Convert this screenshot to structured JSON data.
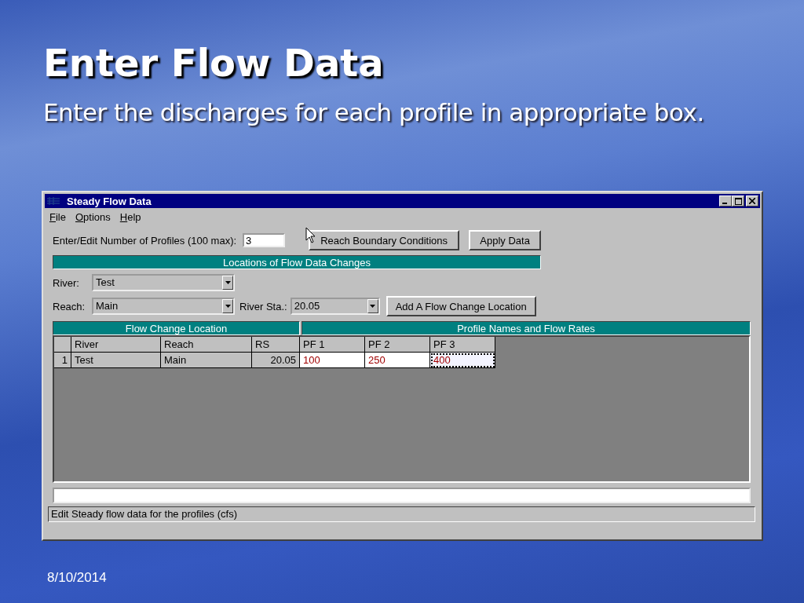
{
  "slide": {
    "title": "Enter Flow Data",
    "subtitle": "Enter the discharges for each profile in appropriate box.",
    "date": "8/10/2014"
  },
  "window": {
    "title": "Steady Flow Data",
    "menu": [
      "File",
      "Options",
      "Help"
    ],
    "profiles": {
      "label": "Enter/Edit Number of Profiles (100 max):",
      "value": "3"
    },
    "buttons": [
      "Reach Boundary Conditions",
      "Apply Data"
    ],
    "section_header": "Locations of Flow Data Changes",
    "river": {
      "label": "River:",
      "value": "Test"
    },
    "reach": {
      "label": "Reach:",
      "value": "Main"
    },
    "river_sta": {
      "label": "River Sta.:",
      "value": "20.05"
    },
    "add_button": "Add A Flow Change Location",
    "table": {
      "group_headers": [
        "Flow Change Location",
        "Profile Names and Flow Rates"
      ],
      "columns": [
        "River",
        "Reach",
        "RS"
      ],
      "profile_columns": [
        "PF 1",
        "PF 2",
        "PF 3"
      ],
      "rows": [
        {
          "number": "1",
          "river": "Test",
          "reach": "Main",
          "rs": "20.05",
          "flows": [
            {
              "value": "100",
              "selected": false
            },
            {
              "value": "250",
              "selected": false
            },
            {
              "value": "400",
              "selected": true
            }
          ]
        }
      ]
    },
    "status_text": "Edit Steady flow data for the profiles (cfs)"
  }
}
